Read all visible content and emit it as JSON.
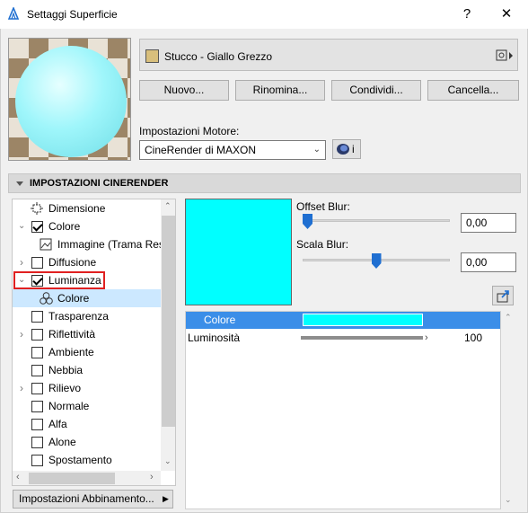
{
  "window": {
    "title": "Settaggi Superficie",
    "help": "?",
    "close": "✕"
  },
  "material": {
    "name": "Stucco - Giallo Grezzo",
    "swatch_color": "#d8bf7c"
  },
  "buttons": {
    "new": "Nuovo...",
    "rename": "Rinomina...",
    "share": "Condividi...",
    "delete": "Cancella..."
  },
  "engine": {
    "label": "Impostazioni Motore:",
    "value": "CineRender di MAXON",
    "info": "i"
  },
  "section": {
    "title": "IMPOSTAZIONI CINERENDER"
  },
  "tree": {
    "items": [
      {
        "label": "Dimensione",
        "checked": null
      },
      {
        "label": "Colore",
        "checked": true
      },
      {
        "label": "Immagine (Trama Resa",
        "checked": null
      },
      {
        "label": "Diffusione",
        "checked": false
      },
      {
        "label": "Luminanza",
        "checked": true
      },
      {
        "label": "Colore",
        "checked": null
      },
      {
        "label": "Trasparenza",
        "checked": false
      },
      {
        "label": "Riflettività",
        "checked": false
      },
      {
        "label": "Ambiente",
        "checked": false
      },
      {
        "label": "Nebbia",
        "checked": false
      },
      {
        "label": "Rilievo",
        "checked": false
      },
      {
        "label": "Normale",
        "checked": false
      },
      {
        "label": "Alfa",
        "checked": false
      },
      {
        "label": "Alone",
        "checked": false
      },
      {
        "label": "Spostamento",
        "checked": false
      }
    ]
  },
  "texture_color": "#00ffff",
  "offset_blur": {
    "label": "Offset Blur:",
    "value": "0,00",
    "slider_fraction": 0.0
  },
  "scale_blur": {
    "label": "Scala Blur:",
    "value": "0,00",
    "slider_fraction": 0.5
  },
  "properties": {
    "color": {
      "label": "Colore",
      "swatch": "#00ffff"
    },
    "brightness": {
      "label": "Luminosità",
      "value": "100"
    }
  },
  "bottom": {
    "label": "Impostazioni Abbinamento..."
  }
}
